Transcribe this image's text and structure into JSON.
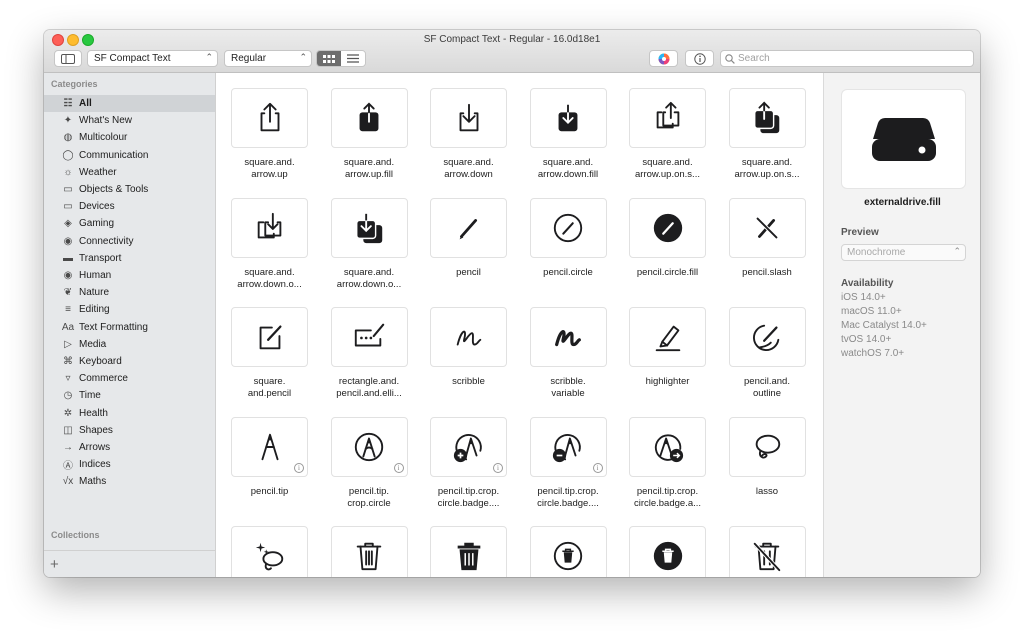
{
  "window": {
    "title": "SF Compact Text - Regular - 16.0d18e1"
  },
  "toolbar": {
    "font_family": "SF Compact Text",
    "font_weight": "Regular",
    "search_placeholder": "Search",
    "icons": {
      "sidebar_toggle": "sidebar-icon",
      "grid_view": "grid-icon",
      "list_view": "list-icon",
      "color": "color-wheel-icon",
      "info": "info-icon",
      "search": "search-icon"
    }
  },
  "sidebar": {
    "categories_header": "Categories",
    "collections_header": "Collections",
    "add_label": "+",
    "items": [
      {
        "label": "All",
        "icon": "grid-icon",
        "glyph": "☷",
        "selected": true
      },
      {
        "label": "What's New",
        "icon": "sparkles-icon",
        "glyph": "✦"
      },
      {
        "label": "Multicolour",
        "icon": "palette-icon",
        "glyph": "◍"
      },
      {
        "label": "Communication",
        "icon": "message-icon",
        "glyph": "◯"
      },
      {
        "label": "Weather",
        "icon": "cloud-sun-icon",
        "glyph": "☼"
      },
      {
        "label": "Objects & Tools",
        "icon": "folder-icon",
        "glyph": "▭"
      },
      {
        "label": "Devices",
        "icon": "display-icon",
        "glyph": "▭"
      },
      {
        "label": "Gaming",
        "icon": "gamecontroller-icon",
        "glyph": "◈"
      },
      {
        "label": "Connectivity",
        "icon": "antenna-icon",
        "glyph": "◉"
      },
      {
        "label": "Transport",
        "icon": "car-icon",
        "glyph": "▬"
      },
      {
        "label": "Human",
        "icon": "person-icon",
        "glyph": "◉"
      },
      {
        "label": "Nature",
        "icon": "leaf-icon",
        "glyph": "❦"
      },
      {
        "label": "Editing",
        "icon": "sliders-icon",
        "glyph": "≡"
      },
      {
        "label": "Text Formatting",
        "icon": "textformat-icon",
        "glyph": "Aa"
      },
      {
        "label": "Media",
        "icon": "playpause-icon",
        "glyph": "▷"
      },
      {
        "label": "Keyboard",
        "icon": "command-icon",
        "glyph": "⌘"
      },
      {
        "label": "Commerce",
        "icon": "cart-icon",
        "glyph": "▿"
      },
      {
        "label": "Time",
        "icon": "timer-icon",
        "glyph": "◷"
      },
      {
        "label": "Health",
        "icon": "health-icon",
        "glyph": "✲"
      },
      {
        "label": "Shapes",
        "icon": "shapes-icon",
        "glyph": "◫"
      },
      {
        "label": "Arrows",
        "icon": "arrow-right-icon",
        "glyph": "→"
      },
      {
        "label": "Indices",
        "icon": "a-circle-icon",
        "glyph": "Ⓐ"
      },
      {
        "label": "Maths",
        "icon": "sqrt-icon",
        "glyph": "√x"
      }
    ]
  },
  "symbols": [
    {
      "label": "square.and.\narrow.up",
      "icon": "square-and-arrow-up-icon",
      "info": false
    },
    {
      "label": "square.and.\narrow.up.fill",
      "icon": "square-and-arrow-up-fill-icon",
      "info": false
    },
    {
      "label": "square.and.\narrow.down",
      "icon": "square-and-arrow-down-icon",
      "info": false
    },
    {
      "label": "square.and.\narrow.down.fill",
      "icon": "square-and-arrow-down-fill-icon",
      "info": false
    },
    {
      "label": "square.and.\narrow.up.on.s...",
      "icon": "square-and-arrow-up-on-square-icon",
      "info": false
    },
    {
      "label": "square.and.\narrow.up.on.s...",
      "icon": "square-and-arrow-up-on-square-fill-icon",
      "info": false
    },
    {
      "label": "square.and.\narrow.down.o...",
      "icon": "square-and-arrow-down-on-square-icon",
      "info": false
    },
    {
      "label": "square.and.\narrow.down.o...",
      "icon": "square-and-arrow-down-on-square-fill-icon",
      "info": false
    },
    {
      "label": "pencil",
      "icon": "pencil-icon",
      "info": false
    },
    {
      "label": "pencil.circle",
      "icon": "pencil-circle-icon",
      "info": false
    },
    {
      "label": "pencil.circle.fill",
      "icon": "pencil-circle-fill-icon",
      "info": false
    },
    {
      "label": "pencil.slash",
      "icon": "pencil-slash-icon",
      "info": false
    },
    {
      "label": "square.\nand.pencil",
      "icon": "square-and-pencil-icon",
      "info": false
    },
    {
      "label": "rectangle.and.\npencil.and.elli...",
      "icon": "rectangle-and-pencil-icon",
      "info": false
    },
    {
      "label": "scribble",
      "icon": "scribble-icon",
      "info": false
    },
    {
      "label": "scribble.\nvariable",
      "icon": "scribble-variable-icon",
      "info": false
    },
    {
      "label": "highlighter",
      "icon": "highlighter-icon",
      "info": false
    },
    {
      "label": "pencil.and.\noutline",
      "icon": "pencil-and-outline-icon",
      "info": false
    },
    {
      "label": "pencil.tip",
      "icon": "pencil-tip-icon",
      "info": true
    },
    {
      "label": "pencil.tip.\ncrop.circle",
      "icon": "pencil-tip-crop-circle-icon",
      "info": true
    },
    {
      "label": "pencil.tip.crop.\ncircle.badge....",
      "icon": "pencil-tip-badge-plus-icon",
      "info": true
    },
    {
      "label": "pencil.tip.crop.\ncircle.badge....",
      "icon": "pencil-tip-badge-minus-icon",
      "info": true
    },
    {
      "label": "pencil.tip.crop.\ncircle.badge.a...",
      "icon": "pencil-tip-badge-arrow-icon",
      "info": false
    },
    {
      "label": "lasso",
      "icon": "lasso-icon",
      "info": false
    },
    {
      "label": "",
      "icon": "lasso-sparkles-icon",
      "info": false
    },
    {
      "label": "",
      "icon": "trash-icon",
      "info": false
    },
    {
      "label": "",
      "icon": "trash-fill-icon",
      "info": false
    },
    {
      "label": "",
      "icon": "trash-circle-icon",
      "info": false
    },
    {
      "label": "",
      "icon": "trash-circle-fill-icon",
      "info": false
    },
    {
      "label": "",
      "icon": "trash-slash-icon",
      "info": false
    }
  ],
  "inspector": {
    "symbol_name": "externaldrive.fill",
    "symbol_icon": "externaldrive-fill-icon",
    "preview_header": "Preview",
    "preview_mode": "Monochrome",
    "availability_header": "Availability",
    "availability": [
      "iOS 14.0+",
      "macOS 11.0+",
      "Mac Catalyst 14.0+",
      "tvOS 14.0+",
      "watchOS 7.0+"
    ]
  }
}
